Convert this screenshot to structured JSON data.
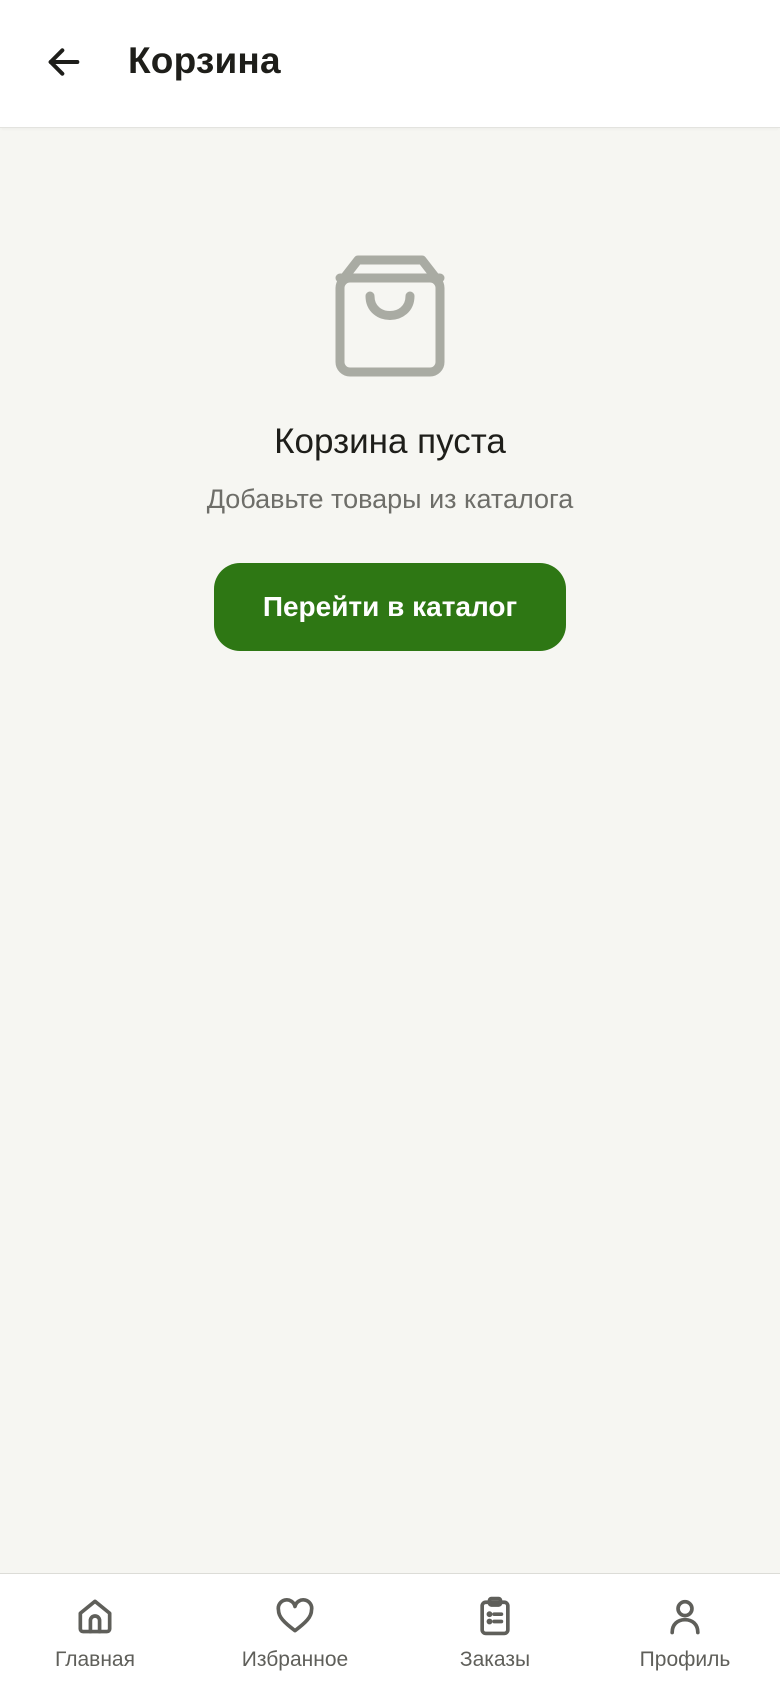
{
  "header": {
    "title": "Корзина",
    "back_icon": "arrow-left-icon"
  },
  "empty_state": {
    "icon": "shopping-bag-icon",
    "title": "Корзина пуста",
    "subtitle": "Добавьте товары из каталога",
    "button_label": "Перейти в каталог"
  },
  "nav": {
    "items": [
      {
        "label": "Главная",
        "icon": "home-icon"
      },
      {
        "label": "Избранное",
        "icon": "heart-icon"
      },
      {
        "label": "Заказы",
        "icon": "clipboard-list-icon"
      },
      {
        "label": "Профиль",
        "icon": "user-icon"
      }
    ]
  },
  "colors": {
    "accent": "#2e7714",
    "background": "#f6f6f2",
    "icon_muted": "#a9aba3",
    "nav_icon": "#5f5f5a"
  }
}
